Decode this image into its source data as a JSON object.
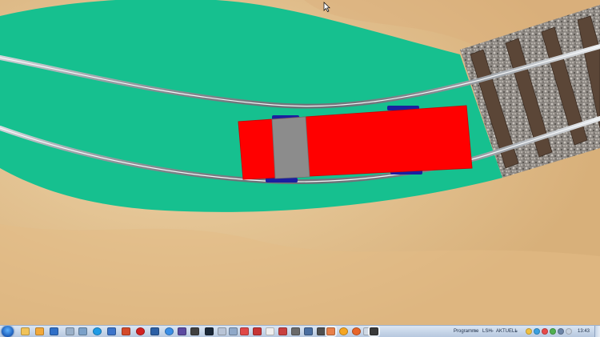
{
  "scene": {
    "colors": {
      "sand": "#e6c596",
      "ground_strip": "#16c08f",
      "rail": "#b8bcc1",
      "ballast": "#8a8580",
      "sleeper": "#5b4637",
      "wagon_body": "#ff0000",
      "wagon_roof_panel": "#8c8c8c",
      "wagon_wheels": "#1a1fa0"
    },
    "cursor_icon": "arrow-cursor-icon"
  },
  "taskbar": {
    "start_icon": "windows-start-icon",
    "pinned_icons": [
      "explorer-icon",
      "files-icon",
      "outlook-icon",
      "app-icon",
      "pen-icon",
      "skype-icon",
      "screen-icon",
      "powerpoint-icon",
      "antivirus-icon",
      "app-icon",
      "cloud-icon",
      "app-icon",
      "app-icon",
      "steam-icon",
      "app-icon",
      "arrow-icon",
      "app-icon",
      "app-icon",
      "close-icon",
      "car-icon",
      "app-icon",
      "app-icon",
      "camera-icon",
      "app-icon",
      "browser-icon",
      "firefox-icon",
      "settings-icon",
      "train-sim-icon"
    ],
    "toolbar_label_programme": "Programme",
    "toolbar_label_lsh": "LSH",
    "toolbar_label_aktuell": "AKTUELL",
    "clock": "13:43"
  }
}
